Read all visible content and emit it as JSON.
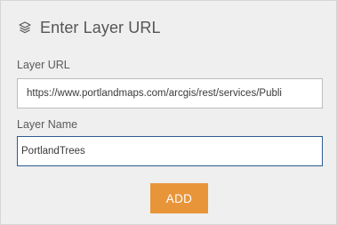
{
  "header": {
    "icon": "layers-icon",
    "title": "Enter Layer URL"
  },
  "layer_url": {
    "label": "Layer URL",
    "value": "https://www.portlandmaps.com/arcgis/rest/services/Publi"
  },
  "layer_name": {
    "label": "Layer Name",
    "value": "PortlandTrees"
  },
  "add_button": {
    "label": "ADD",
    "color": "#e8953a"
  },
  "colors": {
    "panel_background": "#efefef",
    "focused_border": "#2d5b8f"
  }
}
